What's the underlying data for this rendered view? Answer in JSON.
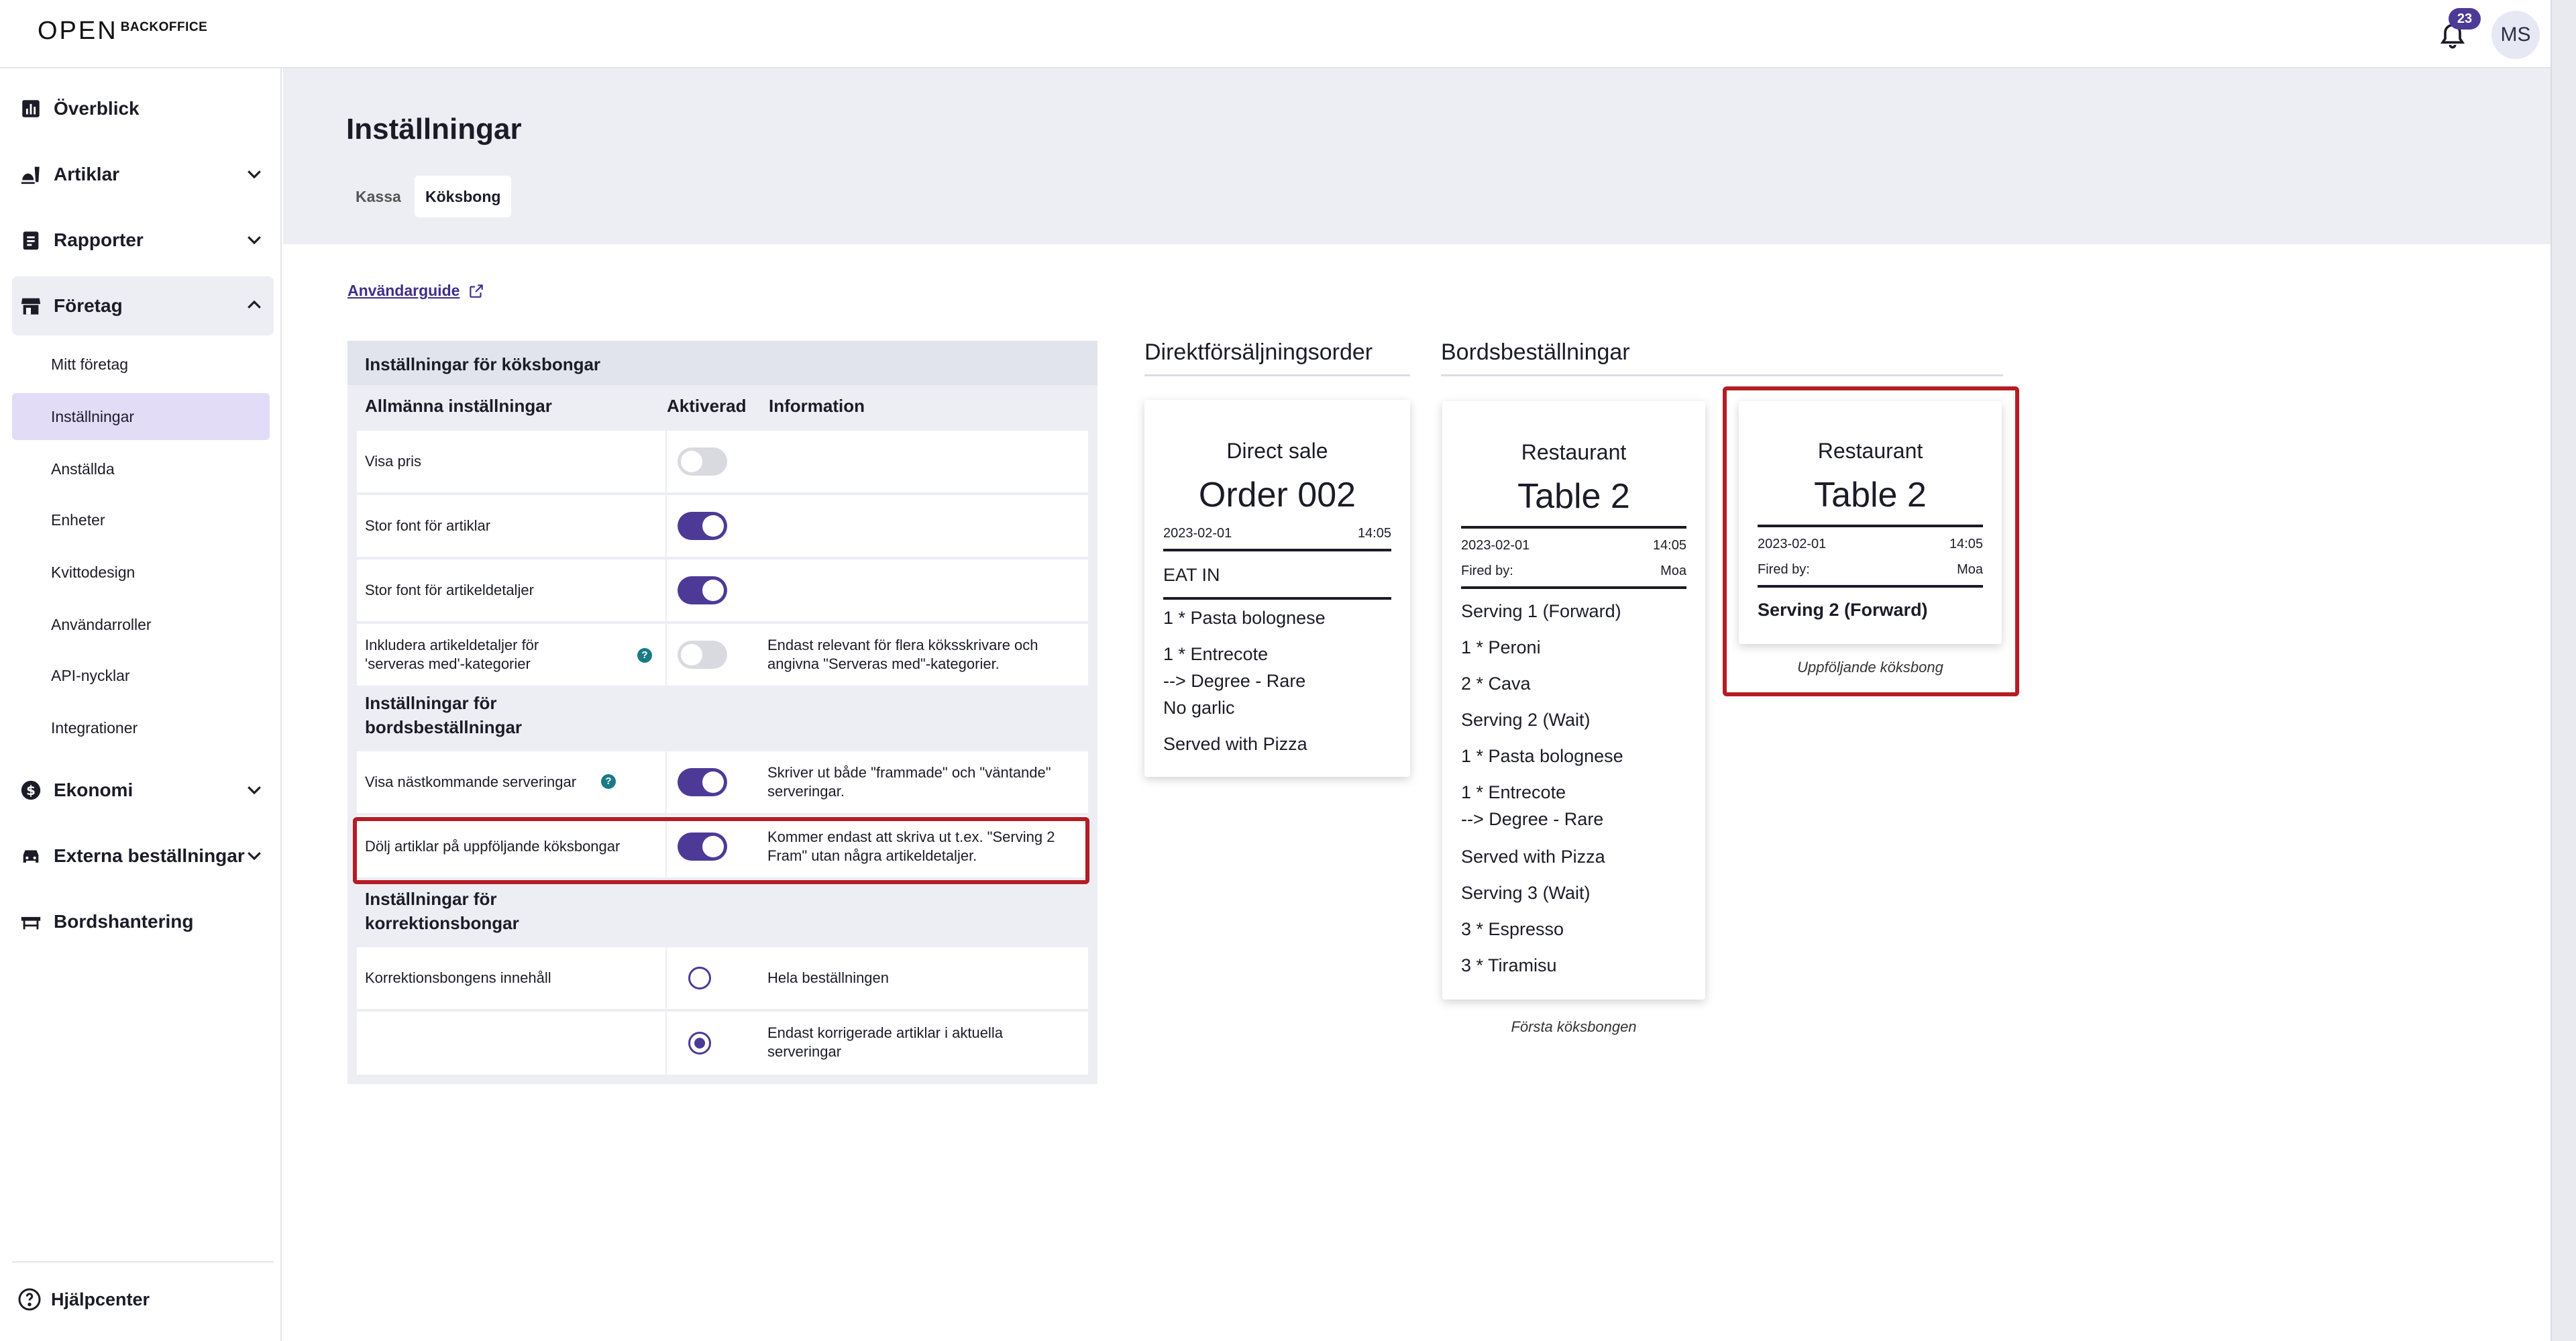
{
  "app": {
    "logo_mark": "OPEN",
    "logo_text": "BACKOFFICE",
    "notification_count": "23",
    "user_initials": "MS"
  },
  "sidebar": {
    "items": [
      {
        "label": "Överblick"
      },
      {
        "label": "Artiklar"
      },
      {
        "label": "Rapporter"
      },
      {
        "label": "Företag"
      },
      {
        "label": "Ekonomi"
      },
      {
        "label": "Externa beställningar"
      },
      {
        "label": "Bordshantering"
      }
    ],
    "company_sub": [
      "Mitt företag",
      "Inställningar",
      "Anställda",
      "Enheter",
      "Kvittodesign",
      "Användarroller",
      "API-nycklar",
      "Integrationer"
    ],
    "help": "Hjälpcenter"
  },
  "page": {
    "title": "Inställningar",
    "tabs": [
      "Kassa",
      "Köksbong"
    ],
    "active_tab": "Köksbong",
    "guide_link": "Användarguide"
  },
  "settings": {
    "header": "Inställningar för köksbongar",
    "columns": {
      "general": "Allmänna inställningar",
      "enabled": "Aktiverad",
      "info": "Information"
    },
    "general": [
      {
        "label": "Visa pris",
        "enabled": false,
        "info": ""
      },
      {
        "label": "Stor font för artiklar",
        "enabled": true,
        "info": ""
      },
      {
        "label": "Stor font för artikeldetaljer",
        "enabled": true,
        "info": ""
      },
      {
        "label_line1": "Inkludera artikeldetaljer för",
        "label_line2": "'serveras med'-kategorier",
        "enabled": false,
        "help": "?",
        "info_line1": "Endast relevant för flera köksskrivare och",
        "info_line2": "angivna \"Serveras med\"-kategorier."
      }
    ],
    "table_section": "Inställningar för bordsbeställningar",
    "table_section_line1": "Inställningar för",
    "table_section_line2": "bordsbeställningar",
    "table": [
      {
        "label": "Visa nästkommande serveringar",
        "enabled": true,
        "help": "?",
        "info_line1": "Skriver ut både \"frammade\" och \"väntande\"",
        "info_line2": "serveringar."
      },
      {
        "label": "Dölj artiklar på uppföljande köksbongar",
        "enabled": true,
        "info_line1": "Kommer endast att skriva ut t.ex. \"Serving 2",
        "info_line2": "Fram\" utan några artikeldetaljer."
      }
    ],
    "correction_section_line1": "Inställningar för",
    "correction_section_line2": "korrektionsbongar",
    "correction": [
      {
        "label": "Korrektionsbongens innehåll",
        "selected": false,
        "info": "Hela beställningen"
      },
      {
        "label": "",
        "selected": true,
        "info_line1": "Endast korrigerade artiklar i aktuella",
        "info_line2": "serveringar"
      }
    ]
  },
  "receipts": {
    "direct_title": "Direktförsäljningsorder",
    "table_title": "Bordsbeställningar",
    "direct": {
      "head": "Direct sale",
      "big": "Order 002",
      "date": "2023-02-01",
      "time": "14:05",
      "mode": "EAT IN",
      "lines": [
        "1 * Pasta bolognese",
        "1 * Entrecote",
        "--> Degree - Rare",
        "No garlic",
        "Served with Pizza"
      ]
    },
    "first": {
      "head": "Restaurant",
      "big": "Table 2",
      "date": "2023-02-01",
      "time": "14:05",
      "fired_label": "Fired by:",
      "fired_by": "Moa",
      "lines": [
        "Serving 1 (Forward)",
        "1 * Peroni",
        "2 * Cava",
        "Serving 2 (Wait)",
        "1 * Pasta bolognese",
        "1 * Entrecote",
        "--> Degree - Rare",
        "Served with Pizza",
        "Serving 3 (Wait)",
        "3 * Espresso",
        "3 * Tiramisu"
      ],
      "caption": "Första köksbongen"
    },
    "followup": {
      "head": "Restaurant",
      "big": "Table 2",
      "date": "2023-02-01",
      "time": "14:05",
      "fired_label": "Fired by:",
      "fired_by": "Moa",
      "line": "Serving 2 (Forward)",
      "caption": "Uppföljande köksbong"
    }
  },
  "colors": {
    "accent": "#4d3a96",
    "highlight": "#b51c24",
    "active_nav": "#e2dcf7",
    "header_bg": "#eceef4"
  }
}
